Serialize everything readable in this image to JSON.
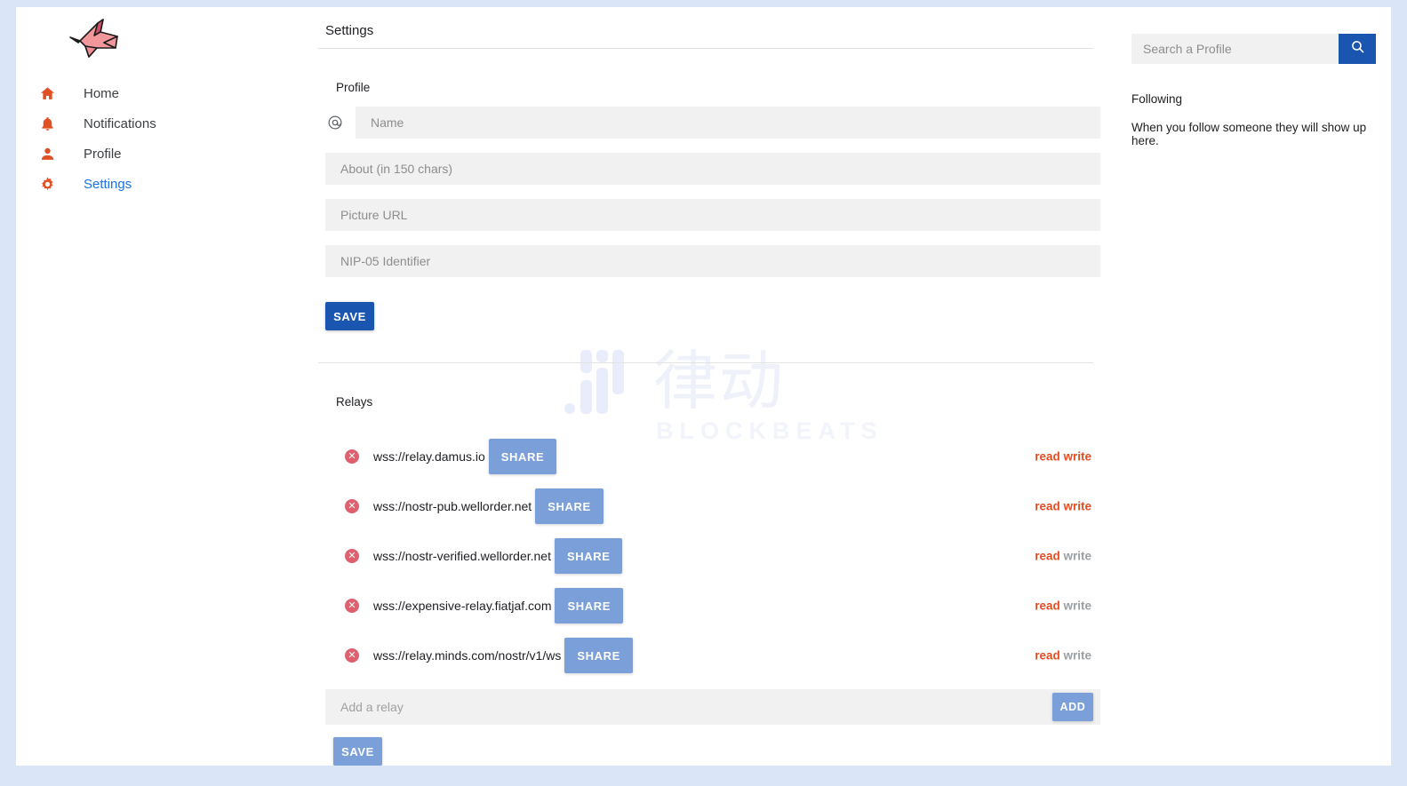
{
  "app": {
    "logo_icon": "origami-crane-logo"
  },
  "sidebar": {
    "items": [
      {
        "label": "Home",
        "icon": "home-icon"
      },
      {
        "label": "Notifications",
        "icon": "bell-icon"
      },
      {
        "label": "Profile",
        "icon": "person-icon"
      },
      {
        "label": "Settings",
        "icon": "gear-icon"
      }
    ]
  },
  "main": {
    "page_title": "Settings",
    "profile": {
      "section_label": "Profile",
      "at_icon": "at-icon",
      "name_placeholder": "Name",
      "name_value": "",
      "about_placeholder": "About (in 150 chars)",
      "about_value": "",
      "picture_placeholder": "Picture URL",
      "picture_value": "",
      "nip05_placeholder": "NIP-05 Identifier",
      "nip05_value": "",
      "save_label": "SAVE"
    },
    "relays": {
      "section_label": "Relays",
      "share_label": "SHARE",
      "delete_icon": "remove-circle-icon",
      "items": [
        {
          "url": "wss://relay.damus.io",
          "read": "read",
          "write": "write",
          "read_active": true,
          "write_active": true
        },
        {
          "url": "wss://nostr-pub.wellorder.net",
          "read": "read",
          "write": "write",
          "read_active": true,
          "write_active": true
        },
        {
          "url": "wss://nostr-verified.wellorder.net",
          "read": "read",
          "write": "write",
          "read_active": true,
          "write_active": false
        },
        {
          "url": "wss://expensive-relay.fiatjaf.com",
          "read": "read",
          "write": "write",
          "read_active": true,
          "write_active": false
        },
        {
          "url": "wss://relay.minds.com/nostr/v1/ws",
          "read": "read",
          "write": "write",
          "read_active": true,
          "write_active": false
        }
      ],
      "add_placeholder": "Add a relay",
      "add_value": "",
      "add_label": "ADD",
      "save_label": "SAVE"
    }
  },
  "rightbar": {
    "search_placeholder": "Search a Profile",
    "search_value": "",
    "search_icon": "search-icon",
    "following_title": "Following",
    "following_note": "When you follow someone they will show up here."
  },
  "watermark": {
    "text_cn": "律动",
    "text_en": "BLOCKBEATS"
  },
  "colors": {
    "accent_orange": "#e14f25",
    "link_blue": "#1a73e8",
    "primary_blue": "#1a56b0",
    "light_blue": "#7b9fd9",
    "delete_red": "#e06070",
    "page_bg_border": "#dbe5f8"
  }
}
